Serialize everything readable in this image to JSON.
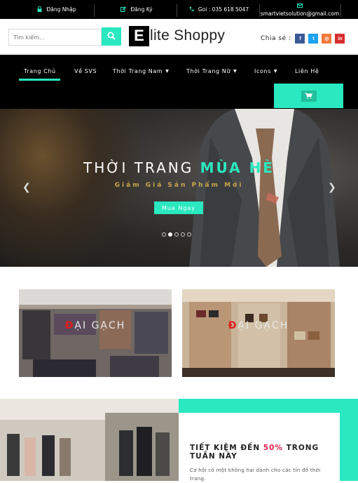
{
  "topbar": {
    "login": "Đăng Nhập",
    "register": "Đăng Ký",
    "phone": "Goi : 035 618 5047",
    "email": "smartvietsolution@gmail.com"
  },
  "header": {
    "search_placeholder": "Tìm kiếm...",
    "logo_letter": "E",
    "logo_rest": "lite Shoppy",
    "share_label": "Chia sẻ :",
    "social": [
      {
        "icon": "facebook-icon",
        "glyph": "f",
        "color": "#3b5998"
      },
      {
        "icon": "twitter-icon",
        "glyph": "t",
        "color": "#1da1f2"
      },
      {
        "icon": "instagram-icon",
        "glyph": "◎",
        "color": "#f37a3b"
      },
      {
        "icon": "linkedin-icon",
        "glyph": "in",
        "color": "#d62d2d"
      }
    ]
  },
  "nav": {
    "items": [
      "Trang Chủ",
      "Về SVS",
      "Thời Trang Nam",
      "Thời Trang Nữ",
      "Icons",
      "Liên Hệ"
    ],
    "active": "Trang Chủ"
  },
  "hero": {
    "title_plain": "THỜI TRANG ",
    "title_highlight": "MÙA HÈ",
    "subtitle": "Giảm Giá Sản Phẩm Mới",
    "button": "Mua Ngay",
    "slides": 5,
    "active_slide": 2
  },
  "promos": [
    {
      "caption_red": "Đ",
      "caption_rest": "ẠI GẠCH"
    },
    {
      "caption_red": "Đ",
      "caption_rest": "ẠI GẠCH"
    }
  ],
  "savings": {
    "heading_before": "TIẾT KIỆM ĐẾN ",
    "heading_pct": "50%",
    "heading_after": " TRONG TUẦN NÀY",
    "text": "Cơ hội có một không hai dành cho các tín đồ thời trang."
  },
  "colors": {
    "accent": "#2ae8c0",
    "promo_red": "#e01b1b",
    "pct_red": "#e6204f"
  }
}
